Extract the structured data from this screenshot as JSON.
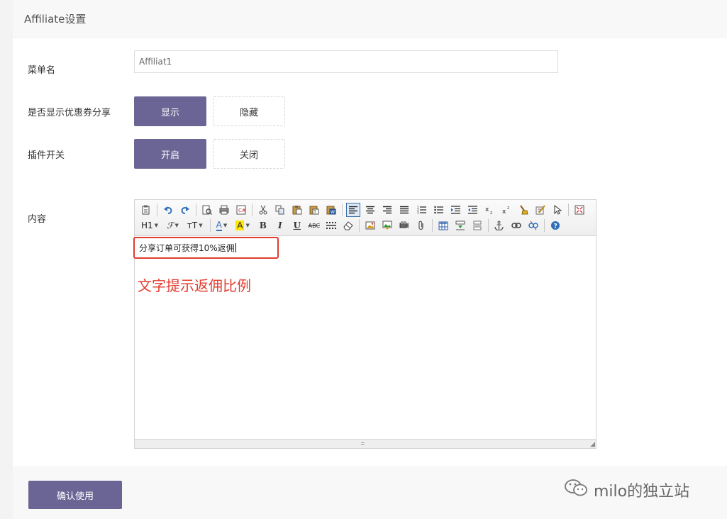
{
  "card": {
    "title": "Affiliate设置"
  },
  "fields": {
    "menu_name": {
      "label": "菜单名",
      "value": "Affiliat1"
    },
    "show_coupon_share": {
      "label": "是否显示优惠券分享",
      "options": [
        "显示",
        "隐藏"
      ],
      "selected": "显示"
    },
    "plugin_switch": {
      "label": "插件开关",
      "options": [
        "开启",
        "关闭"
      ],
      "selected": "开启"
    },
    "content": {
      "label": "内容",
      "text": "分享订单可获得10%返佣"
    }
  },
  "editor": {
    "toolbar_labels": {
      "heading": "H1",
      "font_family": "ℱ",
      "font_size": "ᴛT",
      "font_color": "A",
      "bg_color": "A",
      "bold": "B",
      "italic": "I",
      "underline": "U",
      "strike": "ABC"
    }
  },
  "annotation": {
    "text": "文字提示返佣比例",
    "color": "#e23b2e"
  },
  "footer": {
    "submit_label": "确认使用"
  },
  "watermark": {
    "text": "milo的独立站"
  },
  "colors": {
    "primary": "#6a6595",
    "annotation": "#e23b2e"
  }
}
